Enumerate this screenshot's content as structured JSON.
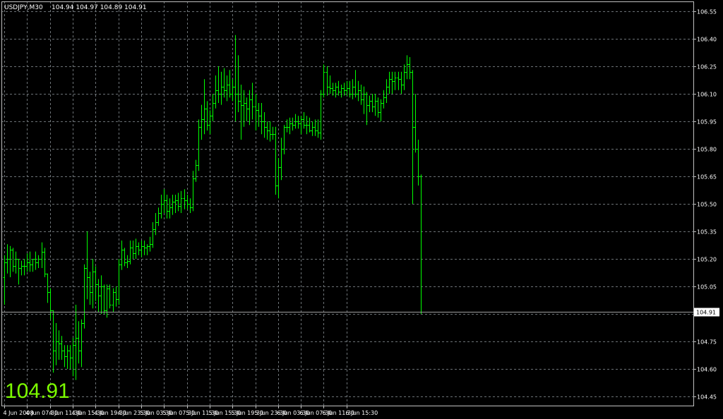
{
  "header": {
    "symbol": "USDJPY,M30",
    "ohlc": "104.94 104.97 104.89 104.91"
  },
  "big_price": "104.91",
  "colors": {
    "background": "#000000",
    "bars": "#00ff00",
    "grid": "#6d7377",
    "frame": "#c0c0c0",
    "current_line": "#a0a0a0",
    "big_price": "#7cfc00",
    "text": "#ffffff"
  },
  "chart_data": {
    "type": "ohlc",
    "title": "USDJPY,M30",
    "timeframe_minutes": 30,
    "grid": true,
    "ylim": [
      104.4,
      106.62
    ],
    "y_ticks": [
      "106.55",
      "106.40",
      "106.25",
      "106.10",
      "105.95",
      "105.80",
      "105.65",
      "105.50",
      "105.35",
      "105.20",
      "105.05",
      "104.90",
      "104.75",
      "104.60",
      "104.45"
    ],
    "x_tick_labels": [
      "4 Jun 2008",
      "4 Jun 07:30",
      "4 Jun 11:30",
      "4 Jun 15:30",
      "4 Jun 19:30",
      "4 Jun 23:30",
      "5 Jun 03:30",
      "5 Jun 07:30",
      "5 Jun 11:30",
      "5 Jun 15:30",
      "5 Jun 19:30",
      "5 Jun 23:30",
      "6 Jun 03:30",
      "6 Jun 07:30",
      "6 Jun 11:30",
      "6 Jun 15:30"
    ],
    "current_price": 104.91,
    "bars_ohlc": [
      [
        105.1,
        105.22,
        104.95,
        105.18
      ],
      [
        105.18,
        105.28,
        105.12,
        105.2
      ],
      [
        105.2,
        105.27,
        105.1,
        105.25
      ],
      [
        105.25,
        105.26,
        105.13,
        105.16
      ],
      [
        105.16,
        105.24,
        105.12,
        105.2
      ],
      [
        105.2,
        105.2,
        105.06,
        105.15
      ],
      [
        105.15,
        105.19,
        105.11,
        105.16
      ],
      [
        105.16,
        105.2,
        105.11,
        105.16
      ],
      [
        105.16,
        105.23,
        105.13,
        105.18
      ],
      [
        105.18,
        105.24,
        105.13,
        105.17
      ],
      [
        105.17,
        105.2,
        105.13,
        105.2
      ],
      [
        105.2,
        105.24,
        105.14,
        105.18
      ],
      [
        105.18,
        105.22,
        105.15,
        105.2
      ],
      [
        105.2,
        105.29,
        105.15,
        105.24
      ],
      [
        105.24,
        105.26,
        105.1,
        105.12
      ],
      [
        105.12,
        105.12,
        104.96,
        105.02
      ],
      [
        105.02,
        105.04,
        104.87,
        104.92
      ],
      [
        104.92,
        104.92,
        104.58,
        104.7
      ],
      [
        104.7,
        104.85,
        104.62,
        104.75
      ],
      [
        104.75,
        104.81,
        104.65,
        104.74
      ],
      [
        104.74,
        104.78,
        104.65,
        104.7
      ],
      [
        104.7,
        104.73,
        104.61,
        104.67
      ],
      [
        104.67,
        104.73,
        104.6,
        104.7
      ],
      [
        104.7,
        104.73,
        104.6,
        104.66
      ],
      [
        104.66,
        104.77,
        104.56,
        104.73
      ],
      [
        104.73,
        104.95,
        104.54,
        104.77
      ],
      [
        104.77,
        104.86,
        104.63,
        104.7
      ],
      [
        104.7,
        104.87,
        104.61,
        104.85
      ],
      [
        104.85,
        105.17,
        104.82,
        105.15
      ],
      [
        105.15,
        105.35,
        104.98,
        105.1
      ],
      [
        105.1,
        105.13,
        104.95,
        105.02
      ],
      [
        105.02,
        105.2,
        104.93,
        105.13
      ],
      [
        105.13,
        105.16,
        104.97,
        105.06
      ],
      [
        105.06,
        105.09,
        104.91,
        105.0
      ],
      [
        105.0,
        105.11,
        104.9,
        105.05
      ],
      [
        105.05,
        105.06,
        104.9,
        104.92
      ],
      [
        104.92,
        105.06,
        104.88,
        105.04
      ],
      [
        105.04,
        105.06,
        104.93,
        104.95
      ],
      [
        104.95,
        105.04,
        104.91,
        105.02
      ],
      [
        105.02,
        105.05,
        104.94,
        104.98
      ],
      [
        104.98,
        105.2,
        104.95,
        105.17
      ],
      [
        105.17,
        105.3,
        105.14,
        105.25
      ],
      [
        105.25,
        105.26,
        105.16,
        105.18
      ],
      [
        105.18,
        105.22,
        105.15,
        105.19
      ],
      [
        105.19,
        105.3,
        105.17,
        105.26
      ],
      [
        105.26,
        105.3,
        105.2,
        105.23
      ],
      [
        105.23,
        105.31,
        105.2,
        105.27
      ],
      [
        105.27,
        105.29,
        105.22,
        105.25
      ],
      [
        105.25,
        105.3,
        105.21,
        105.27
      ],
      [
        105.27,
        105.3,
        105.22,
        105.26
      ],
      [
        105.26,
        105.28,
        105.22,
        105.27
      ],
      [
        105.27,
        105.32,
        105.24,
        105.28
      ],
      [
        105.28,
        105.4,
        105.26,
        105.36
      ],
      [
        105.36,
        105.45,
        105.33,
        105.4
      ],
      [
        105.4,
        105.48,
        105.38,
        105.45
      ],
      [
        105.45,
        105.55,
        105.42,
        105.5
      ],
      [
        105.5,
        105.58,
        105.45,
        105.52
      ],
      [
        105.52,
        105.55,
        105.42,
        105.46
      ],
      [
        105.46,
        105.53,
        105.42,
        105.48
      ],
      [
        105.48,
        105.55,
        105.44,
        105.51
      ],
      [
        105.51,
        105.55,
        105.45,
        105.52
      ],
      [
        105.52,
        105.56,
        105.46,
        105.49
      ],
      [
        105.49,
        105.57,
        105.45,
        105.53
      ],
      [
        105.53,
        105.58,
        105.47,
        105.52
      ],
      [
        105.52,
        105.55,
        105.47,
        105.5
      ],
      [
        105.5,
        105.53,
        105.45,
        105.48
      ],
      [
        105.48,
        105.68,
        105.46,
        105.64
      ],
      [
        105.64,
        105.74,
        105.62,
        105.71
      ],
      [
        105.71,
        105.96,
        105.68,
        105.92
      ],
      [
        105.92,
        106.04,
        105.85,
        105.96
      ],
      [
        105.96,
        106.18,
        105.88,
        106.02
      ],
      [
        106.02,
        106.06,
        105.9,
        105.93
      ],
      [
        105.93,
        106.01,
        105.88,
        105.98
      ],
      [
        105.98,
        106.1,
        105.95,
        106.05
      ],
      [
        106.05,
        106.2,
        106.02,
        106.12
      ],
      [
        106.12,
        106.25,
        106.05,
        106.1
      ],
      [
        106.1,
        106.22,
        106.04,
        106.14
      ],
      [
        106.14,
        106.24,
        106.08,
        106.12
      ],
      [
        106.12,
        106.2,
        106.06,
        106.15
      ],
      [
        106.15,
        106.23,
        106.08,
        106.1
      ],
      [
        106.1,
        106.18,
        106.06,
        106.14
      ],
      [
        106.14,
        106.42,
        105.95,
        106.1
      ],
      [
        106.1,
        106.31,
        106.0,
        106.06
      ],
      [
        106.06,
        106.15,
        105.85,
        106.04
      ],
      [
        106.04,
        106.12,
        105.92,
        106.05
      ],
      [
        106.05,
        106.08,
        105.95,
        106.02
      ],
      [
        106.02,
        106.12,
        105.93,
        106.07
      ],
      [
        106.07,
        106.16,
        105.96,
        106.03
      ],
      [
        106.03,
        106.1,
        105.9,
        106.01
      ],
      [
        106.01,
        106.05,
        105.92,
        105.98
      ],
      [
        105.98,
        106.05,
        105.88,
        105.95
      ],
      [
        105.95,
        106.0,
        105.86,
        105.92
      ],
      [
        105.92,
        105.95,
        105.85,
        105.9
      ],
      [
        105.9,
        105.95,
        105.84,
        105.88
      ],
      [
        105.88,
        105.92,
        105.85,
        105.88
      ],
      [
        105.88,
        105.92,
        105.55,
        105.6
      ],
      [
        105.6,
        105.75,
        105.53,
        105.7
      ],
      [
        105.7,
        105.86,
        105.63,
        105.8
      ],
      [
        105.8,
        105.93,
        105.77,
        105.92
      ],
      [
        105.92,
        105.96,
        105.89,
        105.92
      ],
      [
        105.92,
        105.97,
        105.88,
        105.94
      ],
      [
        105.94,
        105.97,
        105.9,
        105.93
      ],
      [
        105.93,
        105.99,
        105.91,
        105.95
      ],
      [
        105.95,
        105.98,
        105.91,
        105.94
      ],
      [
        105.94,
        105.98,
        105.88,
        105.96
      ],
      [
        105.96,
        106.0,
        105.91,
        105.93
      ],
      [
        105.93,
        105.98,
        105.88,
        105.93
      ],
      [
        105.93,
        105.97,
        105.89,
        105.9
      ],
      [
        105.9,
        105.95,
        105.87,
        105.92
      ],
      [
        105.92,
        105.96,
        105.87,
        105.9
      ],
      [
        105.9,
        105.96,
        105.86,
        105.89
      ],
      [
        105.89,
        106.12,
        105.85,
        106.1
      ],
      [
        106.1,
        106.26,
        106.08,
        106.22
      ],
      [
        106.22,
        106.25,
        106.09,
        106.14
      ],
      [
        106.14,
        106.2,
        106.1,
        106.13
      ],
      [
        106.13,
        106.16,
        106.09,
        106.12
      ],
      [
        106.12,
        106.16,
        106.08,
        106.14
      ],
      [
        106.14,
        106.17,
        106.09,
        106.11
      ],
      [
        106.11,
        106.15,
        106.08,
        106.13
      ],
      [
        106.13,
        106.16,
        106.09,
        106.12
      ],
      [
        106.12,
        106.17,
        106.09,
        106.13
      ],
      [
        106.13,
        106.17,
        106.08,
        106.1
      ],
      [
        106.1,
        106.18,
        106.07,
        106.14
      ],
      [
        106.14,
        106.23,
        106.08,
        106.1
      ],
      [
        106.1,
        106.17,
        106.06,
        106.12
      ],
      [
        106.12,
        106.15,
        106.04,
        106.07
      ],
      [
        106.07,
        106.14,
        105.99,
        106.1
      ],
      [
        106.1,
        106.11,
        105.93,
        106.04
      ],
      [
        106.04,
        106.09,
        106.0,
        106.06
      ],
      [
        106.06,
        106.1,
        106.0,
        106.03
      ],
      [
        106.03,
        106.1,
        105.98,
        106.06
      ],
      [
        106.06,
        106.08,
        105.97,
        106.0
      ],
      [
        106.0,
        106.07,
        105.95,
        106.05
      ],
      [
        106.05,
        106.12,
        106.02,
        106.08
      ],
      [
        106.08,
        106.18,
        106.05,
        106.14
      ],
      [
        106.14,
        106.22,
        106.1,
        106.18
      ],
      [
        106.18,
        106.22,
        106.1,
        106.17
      ],
      [
        106.17,
        106.22,
        106.12,
        106.19
      ],
      [
        106.19,
        106.22,
        106.12,
        106.18
      ],
      [
        106.18,
        106.22,
        106.1,
        106.15
      ],
      [
        106.15,
        106.26,
        106.12,
        106.22
      ],
      [
        106.22,
        106.31,
        106.18,
        106.26
      ],
      [
        106.26,
        106.3,
        106.18,
        106.22
      ],
      [
        106.22,
        106.23,
        105.5,
        105.92
      ],
      [
        105.92,
        106.1,
        105.78,
        105.8
      ],
      [
        105.8,
        105.85,
        105.6,
        105.65
      ],
      [
        105.65,
        105.66,
        104.9,
        104.91
      ]
    ]
  }
}
